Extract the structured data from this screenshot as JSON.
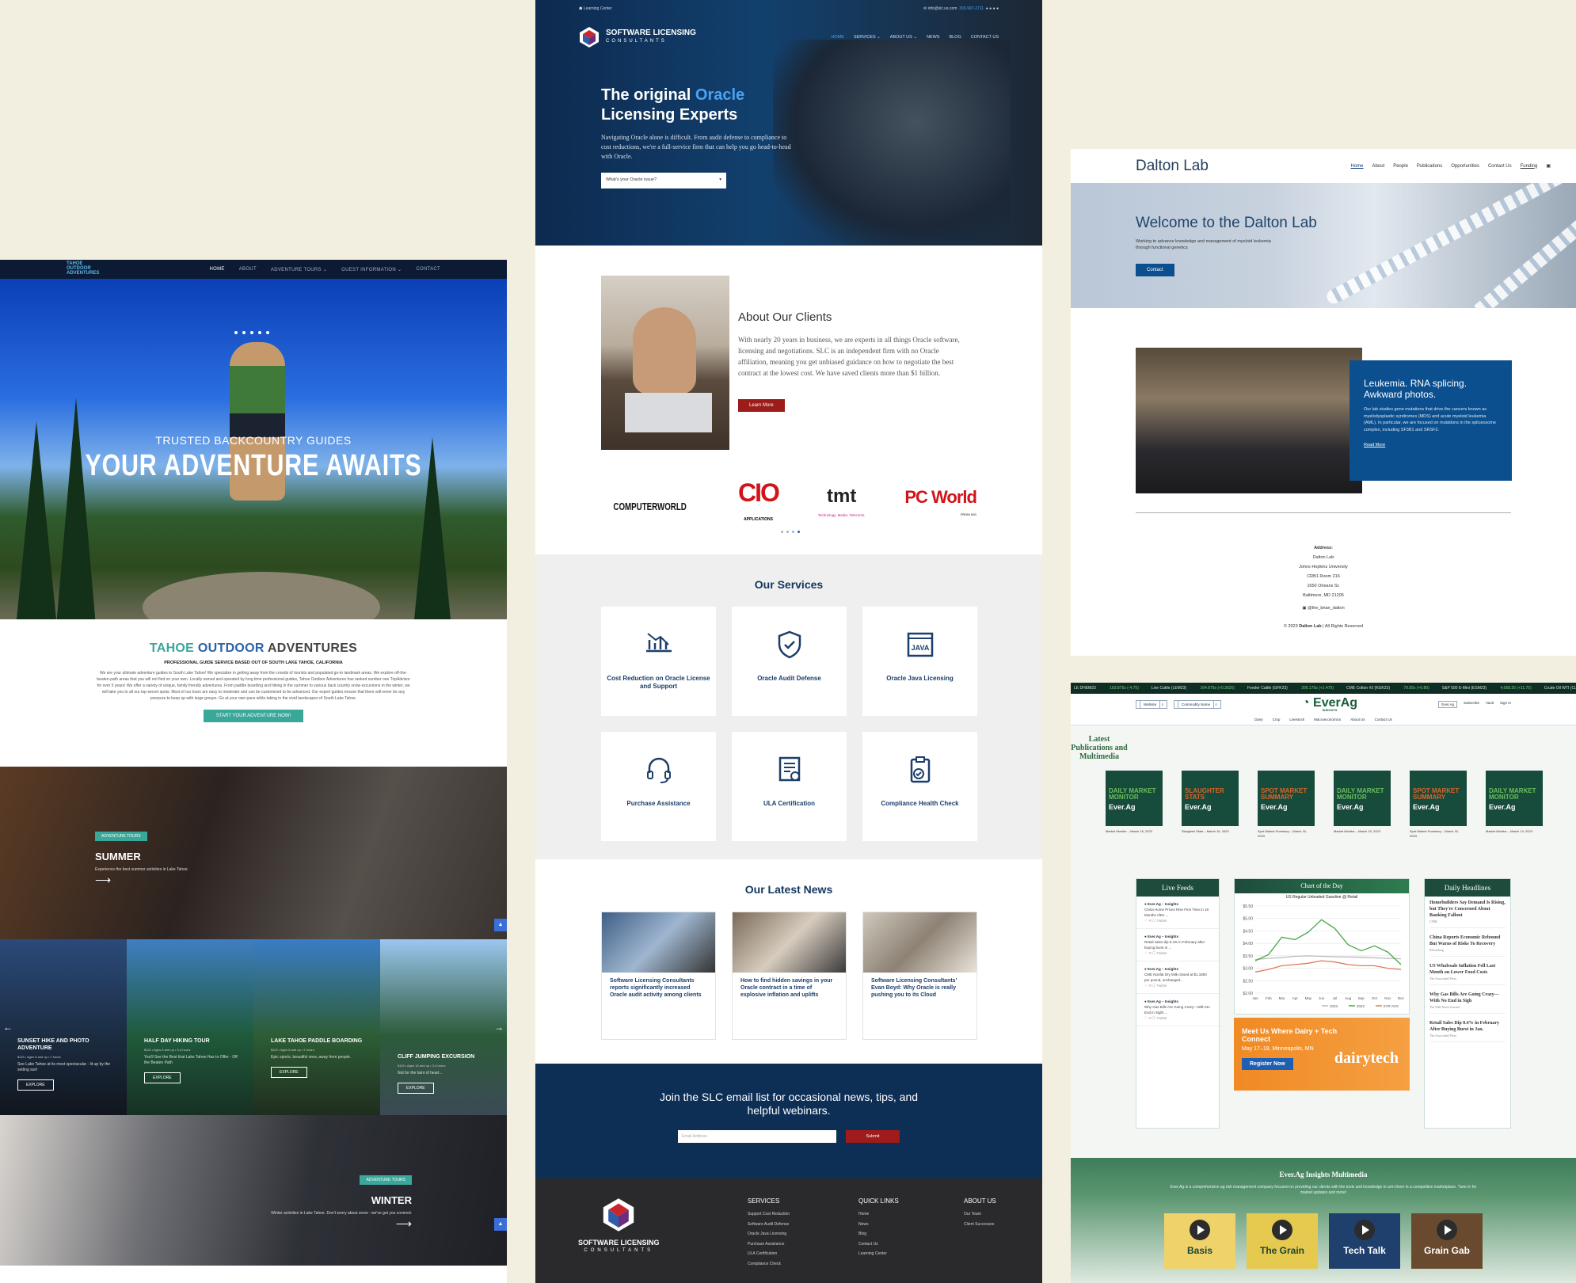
{
  "tahoe": {
    "menu": [
      "HOME",
      "ABOUT",
      "ADVENTURE TOURS ⌄",
      "GUEST INFORMATION ⌄",
      "CONTACT"
    ],
    "hero_kicker": "TRUSTED BACKCOUNTRY GUIDES",
    "hero_title": "YOUR ADVENTURE AWAITS",
    "intro_t1": "TAHOE",
    "intro_t2": "OUTDOOR",
    "intro_t3": "ADVENTURES",
    "intro_sub": "PROFESSIONAL GUIDE SERVICE BASED OUT OF SOUTH LAKE TAHOE, CALIFORNIA",
    "intro_para": "We are your ultimate adventure guides to South Lake Tahoe! We specialize in getting away from the crowds of tourists and populated go-to landmark areas. We explore off-the-beaten-path areas that you will not find on your own. Locally owned and operated by long time professional guides, Tahoe Outdoor Adventures has ranked number one TripAdvisor for over 5 years! We offer a variety of unique, family friendly adventures. From paddle boarding and hiking in the summer to various back country snow excursions in the winter, we will take you to all our top-secret spots. Most of our tours are easy to moderate and can be customized to be advanced. Our expert guides ensure that there will never be any pressure to keep up with large groups. Go at your own pace while taking in the vivid landscapes of South Lake Tahoe.",
    "intro_btn": "START YOUR ADVENTURE NOW!",
    "summer": {
      "tag": "ADVENTURE TOURS",
      "title": "SUMMER",
      "desc": "Experience the best summer activities in Lake Tahoe."
    },
    "tours": [
      {
        "name": "SUNSET HIKE AND PHOTO ADVENTURE",
        "meta": "$115 • Ages 8 and up • 2 hours",
        "desc": "See Lake Tahoe at its most spectacular - lit up by the setting sun!",
        "btn": "EXPLORE"
      },
      {
        "name": "HALF DAY HIKING TOUR",
        "meta": "$115 • Ages 8 and up • 3-4 hours",
        "desc": "You'll See the Best that Lake Tahoe Has to Offer - Off the Beaten Path",
        "btn": "EXPLORE"
      },
      {
        "name": "LAKE TAHOE PADDLE BOARDING",
        "meta": "$115 • Ages 8 and up • 2 hours",
        "desc": "Epic sports, beautiful view, away from people.",
        "btn": "EXPLORE"
      },
      {
        "name": "CLIFF JUMPING EXCURSION",
        "meta": "$115 • Ages 16 and up • 3-4 hours",
        "desc": "Not for the faint of heart...",
        "btn": "EXPLORE"
      }
    ],
    "winter": {
      "tag": "ADVENTURE TOURS",
      "title": "WINTER",
      "desc": "Winter activities in Lake Tahoe. Don't worry about snow - we've got you covered."
    }
  },
  "slc": {
    "topbar_left": "Learning Center",
    "topbar_email": "info@slc.us.com",
    "topbar_phone": "303-997-2711",
    "brand_line1": "SOFTWARE LICENSING",
    "brand_line2": "CONSULTANTS",
    "menu": [
      "HOME",
      "SERVICES ⌄",
      "ABOUT US ⌄",
      "NEWS",
      "BLOG",
      "CONTACT US"
    ],
    "hero_title_a": "The original ",
    "hero_title_b": "Oracle",
    "hero_title_c": "Licensing Experts",
    "hero_lead": "Navigating Oracle alone is difficult. From audit defense to compliance to cost reductions, we're a full-service firm that can help you go head-to-head with Oracle.",
    "hero_select": "What's your Oracle issue?",
    "about_title": "About Our Clients",
    "about_text": "With nearly 20 years in business, we are experts in all things Oracle software, licensing and negotiations. SLC is an independent firm with no Oracle affiliation, meaning you get unbiased guidance on how to negotiate the best contract at the lowest cost. We have saved clients more than $1 billion.",
    "about_btn": "Learn More",
    "logos": {
      "cw": "COMPUTERWORLD",
      "cio": "CIO",
      "cio_sub": "APPLICATIONS",
      "tmt": "tmt",
      "tmt_sub": "Technology. Media. Telecoms.",
      "pcw": "PC World",
      "pcw_sub": "FROM IDG"
    },
    "services_title": "Our Services",
    "services": [
      {
        "label": "Cost Reduction on Oracle License and Support",
        "icon": "chart-down-icon"
      },
      {
        "label": "Oracle Audit Defense",
        "icon": "shield-check-icon"
      },
      {
        "label": "Oracle Java Licensing",
        "icon": "java-icon"
      },
      {
        "label": "Purchase Assistance",
        "icon": "headset-icon"
      },
      {
        "label": "ULA Certification",
        "icon": "certificate-icon"
      },
      {
        "label": "Compliance Health Check",
        "icon": "clipboard-check-icon"
      }
    ],
    "news_title": "Our Latest News",
    "news": [
      {
        "title": "Software Licensing Consultants reports significantly increased Oracle audit activity among clients"
      },
      {
        "title": "How to find hidden savings in your Oracle contract in a time of explosive inflation and uplifts"
      },
      {
        "title": "Software Licensing Consultants' Evan Boyd: Why Oracle is really pushing you to its Cloud"
      }
    ],
    "newsletter": "Join the SLC email list for occasional news, tips, and helpful webinars.",
    "email_placeholder": "Email Address",
    "submit": "Submit",
    "footer": {
      "services_h": "SERVICES",
      "services": [
        "Support Cost Reduction",
        "Software Audit Defense",
        "Oracle Java Licensing",
        "Purchase Assistance",
        "ULA Certification",
        "Compliance Check"
      ],
      "quick_h": "QUICK LINKS",
      "quick": [
        "Home",
        "News",
        "Blog",
        "Contact Us",
        "Learning Center"
      ],
      "about_h": "ABOUT US",
      "about": [
        "Our Team",
        "Client Successes"
      ]
    }
  },
  "dalton": {
    "name": "Dalton Lab",
    "menu": [
      "Home",
      "About",
      "People",
      "Publications",
      "Opportunities",
      "Contact Us",
      "Funding"
    ],
    "hero_title": "Welcome to the Dalton Lab",
    "hero_text": "Working to advance knowledge and management of myeloid leukemia through functional genetics",
    "hero_btn": "Contact",
    "feature_title": "Leukemia. RNA splicing. Awkward photos.",
    "feature_text": "Our lab studies gene mutations that drive the cancers known as myelodysplastic syndromes (MDS) and acute myeloid leukemia (AML). In particular, we are focused on mutations in the spliceosome complex, including SF3B1 and SRSF2.",
    "feature_link": "Read More",
    "addr_label": "Address:",
    "addr": [
      "Dalton Lab",
      "Johns Hopkins University",
      "CRB1 Room 216",
      "1650 Orleans St.",
      "Baltimore, MD 21205"
    ],
    "twitter": "@the_brian_dalton",
    "copyright_a": "© 2023 ",
    "copyright_b": "Dalton Lab",
    "copyright_c": " | All Rights Reserved"
  },
  "everag": {
    "ticker": [
      {
        "name": "LE DHEM23",
        "val": "163.875s (-4.75)"
      },
      {
        "name": "Live Cattle (LEM23)",
        "val": "164.875s (+0.3625)"
      },
      {
        "name": "Feeder Cattle (GFK23)",
        "val": "205.175s (+1.475)"
      },
      {
        "name": "CME Cotton #2 (KGK23)",
        "val": "79.55s (+0.80)"
      },
      {
        "name": "S&P 500 E-Mini (ESM23)",
        "val": "4,068.25 (+11.75)"
      },
      {
        "name": "Crude Oil WTI (CLJ23)",
        "val": ""
      }
    ],
    "search1": "Website",
    "search2": "Commodity Name",
    "logo": "EverAg",
    "logo_sub": "INSIGHTS",
    "right_links": [
      "Ever.Ag",
      "Subscribe",
      "Vault",
      "Sign In"
    ],
    "subnav": [
      "Dairy",
      "Crop",
      "Livestock",
      "Macroeconomics",
      "About Us",
      "Contact Us"
    ],
    "pub_title": "Latest Publications and Multimedia",
    "pubs": [
      {
        "cover": "DAILY MARKET MONITOR",
        "cap": "Market Monitor – March 16, 2023"
      },
      {
        "cover": "SLAUGHTER STATS",
        "cap": "Slaughter Stats – March 16, 2023"
      },
      {
        "cover": "SPOT MARKET SUMMARY",
        "cap": "Spot Market Summary – March 16, 2023"
      },
      {
        "cover": "DAILY MARKET MONITOR",
        "cap": "Market Monitor – March 15, 2023"
      },
      {
        "cover": "SPOT MARKET SUMMARY",
        "cap": "Spot Market Summary – March 15, 2023"
      },
      {
        "cover": "DAILY MARKET MONITOR",
        "cap": "Market Monitor – March 14, 2023"
      }
    ],
    "cover_brand": "Ever.Ag",
    "feeds_title": "Live Feeds",
    "feeds": [
      {
        "who": "Ever.Ag – Insights",
        "txt": "China Home Prices Rise First Time in 18 Months After ..."
      },
      {
        "who": "Ever.Ag – Insights",
        "txt": "Retail sales dip 0.4% in February after buying burst in ..."
      },
      {
        "who": "Ever.Ag – Insights",
        "txt": "CME Nonfat Dry Milk closed at $1.1800 per pound, unchanged..."
      },
      {
        "who": "Ever.Ag – Insights",
        "txt": "Why Gas Bills Are Going Crazy—With No End in Sight ..."
      }
    ],
    "chart_title": "Chart of the Day",
    "ad_h": "Meet Us Where Dairy + Tech Connect",
    "ad_d": "May 17–18, Minneapolis, MN",
    "ad_b": "Register Now",
    "ad_logo": "dairytech",
    "heads_title": "Daily Headlines",
    "heads": [
      {
        "t": "Homebuilders Say Demand Is Rising, but They're Concerned About Banking Fallout",
        "s": "CNBC"
      },
      {
        "t": "China Reports Economic Rebound But Warns of Risks To Recovery",
        "s": "Bloomberg"
      },
      {
        "t": "US Wholesale Inflation Fell Last Month on Lower Food Costs",
        "s": "The Associated Press"
      },
      {
        "t": "Why Gas Bills Are Going Crazy—With No End in Sigh",
        "s": "The Wall Street Journal"
      },
      {
        "t": "Retail Sales Dip 0.4% in February After Buying Burst in Jan.",
        "s": "The Associated Press"
      }
    ],
    "mm_title": "Ever.Ag Insights Multimedia",
    "mm_text": "Ever.Ag is a comprehensive ag risk management company focused on providing our clients with the tools and knowledge to arm them in a competitive marketplace. Tune in for market updates and more!",
    "videos": [
      "Basis",
      "The Grain",
      "Tech Talk",
      "Grain Gab"
    ]
  },
  "chart_data": {
    "type": "line",
    "title": "US Regular Unleaded Gasoline @ Retail",
    "categories": [
      "Jan",
      "Feb",
      "Mar",
      "Apr",
      "May",
      "Jun",
      "Jul",
      "Aug",
      "Sep",
      "Oct",
      "Nov",
      "Dec"
    ],
    "ylim": [
      2.0,
      5.5
    ],
    "yticks": [
      "$2.00",
      "$2.50",
      "$3.00",
      "$3.50",
      "$4.00",
      "$4.50",
      "$5.00",
      "$5.50"
    ],
    "series": [
      {
        "name": "2023",
        "color": "#b9b9b9",
        "values": [
          3.35,
          3.4,
          3.43,
          3.48,
          3.5,
          3.48,
          3.46,
          3.45,
          3.44,
          3.42,
          3.4,
          3.38
        ]
      },
      {
        "name": "2022",
        "color": "#4aa84a",
        "values": [
          3.3,
          3.55,
          4.25,
          4.15,
          4.45,
          4.95,
          4.6,
          3.95,
          3.7,
          3.9,
          3.65,
          3.15
        ]
      },
      {
        "name": "5YR AVG",
        "color": "#e07b5c",
        "values": [
          2.85,
          2.95,
          3.1,
          3.15,
          3.2,
          3.3,
          3.25,
          3.15,
          3.1,
          3.1,
          3.0,
          2.95
        ]
      }
    ]
  }
}
